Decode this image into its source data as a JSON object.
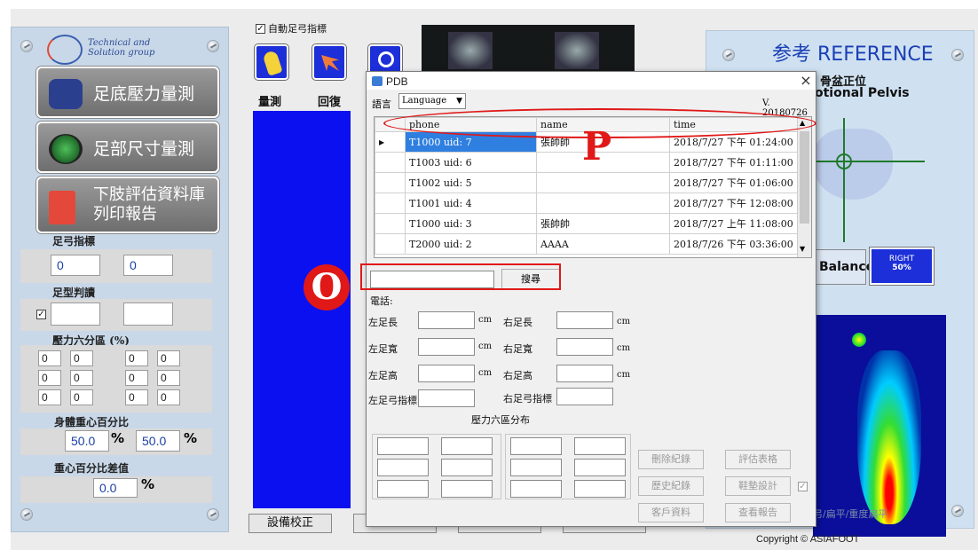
{
  "toolbar": {
    "auto_arch_label": "自動足弓指標",
    "auto_arch_checked": "☑",
    "measure_label": "量測",
    "replay_label": "回復"
  },
  "left": {
    "logo_line1": "Technical and",
    "logo_line2": "Solution group",
    "btn_plantar": "足底壓力量測",
    "btn_foot_size": "足部尺寸量測",
    "btn_report_line1": "下肢評估資料庫",
    "btn_report_line2": "列印報告",
    "arch_label": "足弓指標",
    "arch_left": "0",
    "arch_right": "0",
    "foot_type_label": "足型判讀",
    "pressure_label": "壓力六分區 (%)",
    "pressure_values": [
      "0",
      "0",
      "0",
      "0",
      "0",
      "0",
      "0",
      "0",
      "0",
      "0",
      "0",
      "0"
    ],
    "cog_label": "身體重心百分比",
    "cog_left": "50.0",
    "cog_right": "50.0",
    "percent": "%",
    "cog_diff_label": "重心百分比差值",
    "cog_diff": "0.0"
  },
  "bottom": {
    "calibrate_label": "設備校正"
  },
  "right": {
    "ref_cn": "参考",
    "ref_en": "REFERENCE",
    "pelvis_cn": "骨盆正位",
    "pelvis_en": "otional Pelvis",
    "balance_label": "Balance",
    "right_label": "RIGHT",
    "right_value": "50%",
    "legend": "弓/扁平/重度扁平",
    "copyright": "Copyright © ASIAFOOT"
  },
  "dialog": {
    "title": "PDB",
    "lang_label": "語言",
    "lang_value": "Language",
    "version": "V. 20180726",
    "columns": [
      "phone",
      "name",
      "time"
    ],
    "rows": [
      {
        "phone": "T1000 uid: 7",
        "name": "張帥帥",
        "time": "2018/7/27 下午 01:24:00"
      },
      {
        "phone": "T1003 uid: 6",
        "name": "",
        "time": "2018/7/27 下午 01:11:00"
      },
      {
        "phone": "T1002 uid: 5",
        "name": "",
        "time": "2018/7/27 下午 01:06:00"
      },
      {
        "phone": "T1001 uid: 4",
        "name": "",
        "time": "2018/7/27 下午 12:08:00"
      },
      {
        "phone": "T1000 uid: 3",
        "name": "張帥帥",
        "time": "2018/7/27 上午 11:08:00"
      },
      {
        "phone": "T2000 uid: 2",
        "name": "AAAA",
        "time": "2018/7/26 下午 03:36:00"
      }
    ],
    "search_label": "搜尋",
    "search_value": "",
    "phone_label": "電話:",
    "left_length": "左足長",
    "right_length": "右足長",
    "left_width": "左足寬",
    "right_width": "右足寬",
    "left_height": "左足高",
    "right_height": "右足高",
    "left_arch": "左足弓指標",
    "right_arch": "右足弓指標",
    "cm": "cm",
    "pressure_dist": "壓力六區分布",
    "btn_delete": "刪除紀錄",
    "btn_history": "歷史紀錄",
    "btn_customer": "客戶資料",
    "btn_eval": "評估表格",
    "btn_shoe": "鞋墊設計",
    "btn_report": "查看報告"
  },
  "annotations": {
    "p_letter": "P",
    "o_letter": "O"
  },
  "colors": {
    "accent_blue": "#1c2fd8",
    "annotation_red": "#e01818",
    "selection_blue": "#2f7fe0"
  }
}
